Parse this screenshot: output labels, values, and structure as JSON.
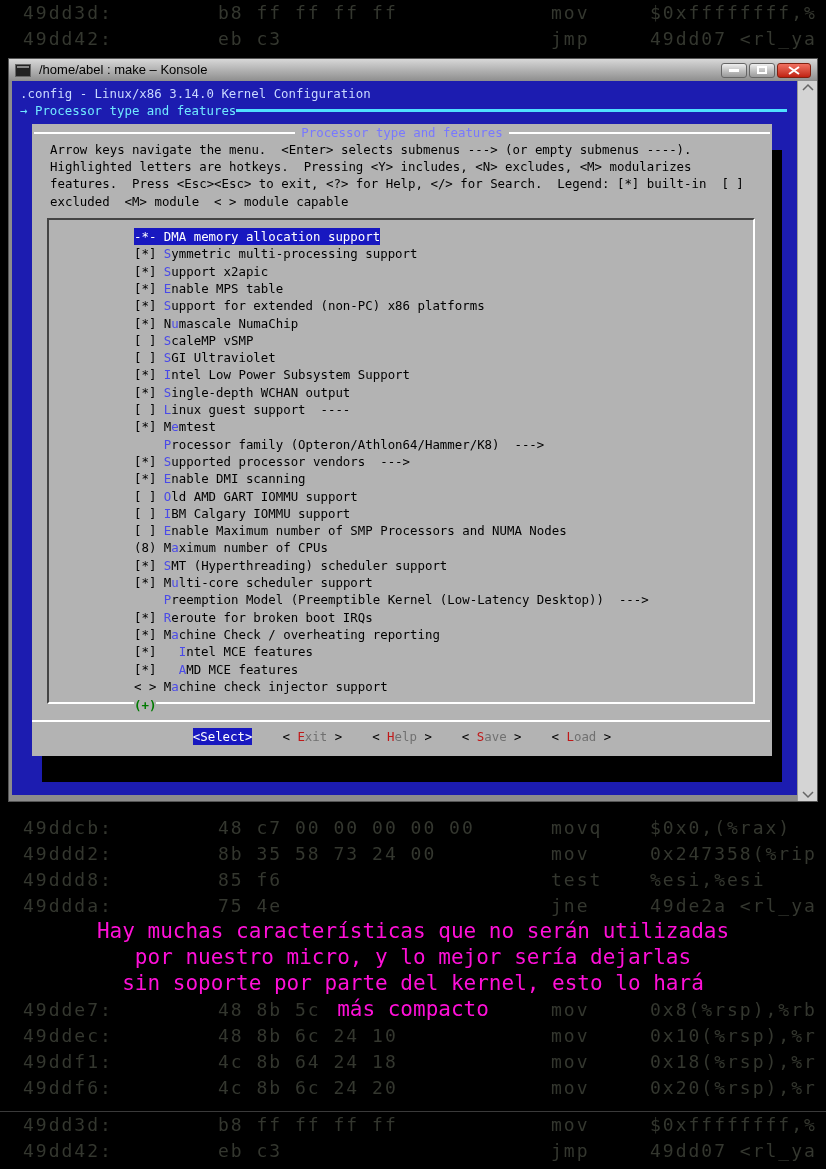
{
  "background_listing": {
    "top_rows": [
      {
        "address": "49dd3d:",
        "bytes": "b8 ff ff ff ff",
        "mnemonic": "mov",
        "operands": "$0xffffffff,%"
      },
      {
        "address": "49dd42:",
        "bytes": "eb c3",
        "mnemonic": "jmp",
        "operands": "49dd07 <rl_ya"
      }
    ],
    "middle_rows": [
      {
        "address": "49ddcb:",
        "bytes": "48 c7 00 00 00 00 00",
        "mnemonic": "movq",
        "operands": "$0x0,(%rax)"
      },
      {
        "address": "49ddd2:",
        "bytes": "8b 35 58 73 24 00",
        "mnemonic": "mov",
        "operands": "0x247358(%rip"
      },
      {
        "address": "49ddd8:",
        "bytes": "85 f6",
        "mnemonic": "test",
        "operands": "%esi,%esi"
      },
      {
        "address": "49ddda:",
        "bytes": "75 4e",
        "mnemonic": "jne",
        "operands": "49de2a <rl_ya"
      }
    ],
    "lower_rows": [
      {
        "address": "49dde7:",
        "bytes": "48 8b 5c",
        "mnemonic": "mov",
        "operands": "0x8(%rsp),%rb"
      },
      {
        "address": "49ddec:",
        "bytes": "48 8b 6c 24 10",
        "mnemonic": "mov",
        "operands": "0x10(%rsp),%r"
      },
      {
        "address": "49ddf1:",
        "bytes": "4c 8b 64 24 18",
        "mnemonic": "mov",
        "operands": "0x18(%rsp),%r"
      },
      {
        "address": "49ddf6:",
        "bytes": "4c 8b 6c 24 20",
        "mnemonic": "mov",
        "operands": "0x20(%rsp),%r"
      }
    ],
    "bottom_rows": [
      {
        "address": "49dd3d:",
        "bytes": "b8 ff ff ff ff",
        "mnemonic": "mov",
        "operands": "$0xffffffff,%"
      },
      {
        "address": "49dd42:",
        "bytes": "eb c3",
        "mnemonic": "jmp",
        "operands": "49dd07 <rl_ya"
      }
    ]
  },
  "window": {
    "title": "/home/abel : make – Konsole"
  },
  "terminal": {
    "header": ".config - Linux/x86 3.14.0 Kernel Configuration",
    "breadcrumb_arrow": "→",
    "breadcrumb": "Processor type and features",
    "dialog": {
      "title": "Processor type and features",
      "help_lines": [
        "Arrow keys navigate the menu.  <Enter> selects submenus ---> (or empty submenus ----).",
        "Highlighted letters are hotkeys.  Pressing <Y> includes, <N> excludes, <M> modularizes",
        "features.  Press <Esc><Esc> to exit, <?> for Help, </> for Search.  Legend: [*] built-in  [ ]",
        "excluded  <M> module  < > module capable"
      ],
      "items": [
        {
          "marker": "-*-",
          "hotkey": "D",
          "after": "MA memory allocation support",
          "selected": true
        },
        {
          "marker": "[*]",
          "hotkey": "S",
          "after": "ymmetric multi-processing support",
          "selected": false
        },
        {
          "marker": "[*]",
          "hotkey": "S",
          "after": "upport x2apic",
          "selected": false
        },
        {
          "marker": "[*]",
          "hotkey": "E",
          "after": "nable MPS table",
          "selected": false
        },
        {
          "marker": "[*]",
          "hotkey": "S",
          "after": "upport for extended (non-PC) x86 platforms",
          "selected": false
        },
        {
          "marker": "[*]",
          "before": "N",
          "hotkey": "u",
          "after": "mascale NumaChip",
          "selected": false
        },
        {
          "marker": "[ ]",
          "hotkey": "S",
          "after": "caleMP vSMP",
          "selected": false
        },
        {
          "marker": "[ ]",
          "hotkey": "S",
          "after": "GI Ultraviolet",
          "selected": false
        },
        {
          "marker": "[*]",
          "hotkey": "I",
          "after": "ntel Low Power Subsystem Support",
          "selected": false
        },
        {
          "marker": "[*]",
          "hotkey": "S",
          "after": "ingle-depth WCHAN output",
          "selected": false
        },
        {
          "marker": "[ ]",
          "hotkey": "L",
          "after": "inux guest support  ----",
          "selected": false
        },
        {
          "marker": "[*]",
          "before": "M",
          "hotkey": "e",
          "after": "mtest",
          "selected": false
        },
        {
          "hotkey": "P",
          "after": "rocessor family (Opteron/Athlon64/Hammer/K8)  --->",
          "selected": false
        },
        {
          "marker": "[*]",
          "hotkey": "S",
          "after": "upported processor vendors  --->",
          "selected": false
        },
        {
          "marker": "[*]",
          "hotkey": "E",
          "after": "nable DMI scanning",
          "selected": false
        },
        {
          "marker": "[ ]",
          "hotkey": "O",
          "after": "ld AMD GART IOMMU support",
          "selected": false
        },
        {
          "marker": "[ ]",
          "hotkey": "I",
          "after": "BM Calgary IOMMU support",
          "selected": false
        },
        {
          "marker": "[ ]",
          "hotkey": "E",
          "after": "nable Maximum number of SMP Processors and NUMA Nodes",
          "selected": false
        },
        {
          "marker": "(8)",
          "before": "M",
          "hotkey": "a",
          "after": "ximum number of CPUs",
          "selected": false
        },
        {
          "marker": "[*]",
          "hotkey": "S",
          "after": "MT (Hyperthreading) scheduler support",
          "selected": false
        },
        {
          "marker": "[*]",
          "before": "M",
          "hotkey": "u",
          "after": "lti-core scheduler support",
          "selected": false
        },
        {
          "hotkey": "P",
          "after": "reemption Model (Preemptible Kernel (Low-Latency Desktop))  --->",
          "selected": false
        },
        {
          "marker": "[*]",
          "hotkey": "R",
          "after": "eroute for broken boot IRQs",
          "selected": false
        },
        {
          "marker": "[*]",
          "before": "M",
          "hotkey": "a",
          "after": "chine Check / overheating reporting",
          "selected": false,
          "children": [
            {
              "marker": "[*]",
              "hotkey": "I",
              "after": "ntel MCE features",
              "selected": false
            },
            {
              "marker": "[*]",
              "hotkey": "A",
              "after": "MD MCE features",
              "selected": false
            }
          ]
        },
        {
          "marker": "< >",
          "before": "M",
          "hotkey": "a",
          "after": "chine check injector support",
          "selected": false
        }
      ],
      "more_indicator": "(+)",
      "buttons": [
        {
          "open": "<",
          "hotkey": "S",
          "rest": "elect",
          "close": ">",
          "selected": true
        },
        {
          "open": "<",
          "hotkey": "E",
          "rest": "xit",
          "close": ">",
          "selected": false
        },
        {
          "open": "<",
          "hotkey": "H",
          "rest": "elp",
          "close": ">",
          "selected": false
        },
        {
          "open": "<",
          "hotkey": "S",
          "rest": "ave",
          "close": ">",
          "selected": false
        },
        {
          "open": "<",
          "hotkey": "L",
          "rest": "oad",
          "close": ">",
          "selected": false
        }
      ]
    }
  },
  "subtitle": [
    "Hay muchas características que no serán utilizadas",
    "por nuestro micro, y lo mejor sería dejarlas",
    "sin soporte por parte del kernel, esto lo hará",
    "más compacto"
  ]
}
